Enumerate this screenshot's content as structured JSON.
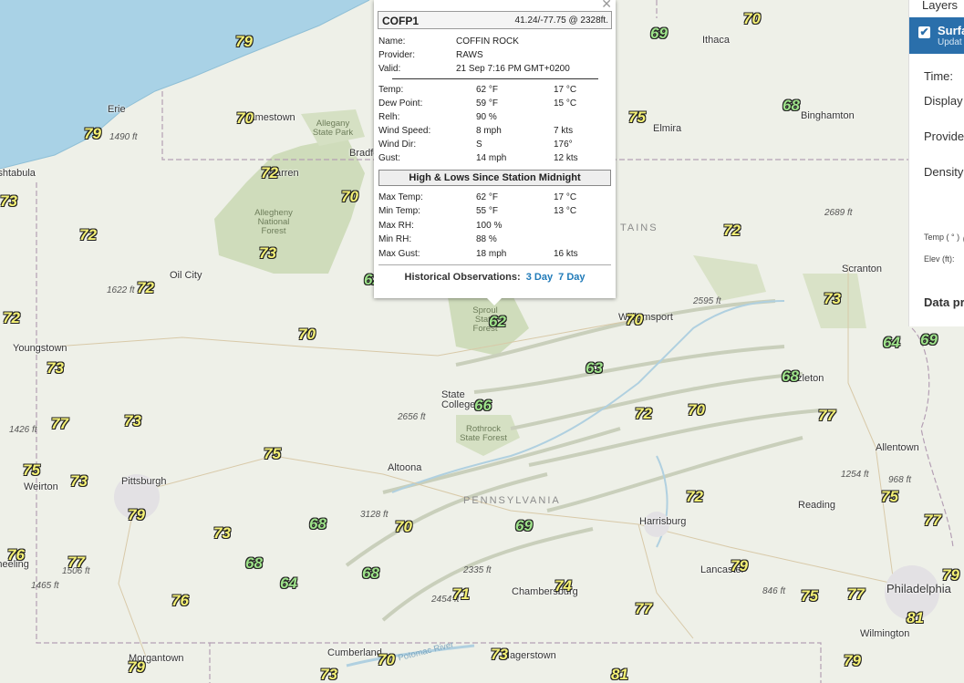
{
  "popup": {
    "station_id": "COFP1",
    "lat_lon_elev": "41.24/-77.75 @ 2328ft.",
    "name_label": "Name:",
    "name_value": "COFFIN ROCK",
    "provider_label": "Provider:",
    "provider_value": "RAWS",
    "valid_label": "Valid:",
    "valid_value": "21 Sep 7:16 PM GMT+0200",
    "obs": [
      {
        "label": "Temp:",
        "english": "62 °F",
        "metric": "17 °C"
      },
      {
        "label": "Dew Point:",
        "english": "59 °F",
        "metric": "15 °C"
      },
      {
        "label": "Relh:",
        "english": "90 %",
        "metric": ""
      },
      {
        "label": "Wind Speed:",
        "english": "8 mph",
        "metric": "7 kts"
      },
      {
        "label": "Wind Dir:",
        "english": "S",
        "metric": "176°"
      },
      {
        "label": "Gust:",
        "english": "14 mph",
        "metric": "12 kts"
      }
    ],
    "section_title": "High & Lows Since Station Midnight",
    "highs_lows": [
      {
        "label": "Max Temp:",
        "english": "62 °F",
        "metric": "17 °C"
      },
      {
        "label": "Min Temp:",
        "english": "55 °F",
        "metric": "13 °C"
      },
      {
        "label": "Max RH:",
        "english": "100 %",
        "metric": ""
      },
      {
        "label": "Min RH:",
        "english": "88 %",
        "metric": ""
      },
      {
        "label": "Max Gust:",
        "english": "18 mph",
        "metric": "16 kts"
      }
    ],
    "historical_label": "Historical Observations:",
    "link_3day": "3 Day",
    "link_7day": "7 Day"
  },
  "panel": {
    "layers_title": "Layers",
    "layer_name": "Surfa",
    "layer_sub": "Updat",
    "time_label": "Time:",
    "display_label": "Display",
    "provider_label": "Provide",
    "density_label": "Density",
    "temp_label": "Temp ( ° )",
    "elev_label": "Elev (ft):",
    "data_label": "Data pr"
  },
  "map": {
    "cities": [
      "Erie",
      "Jamestown",
      "Bradford",
      "Elmira",
      "Binghamton",
      "Ashtabula",
      "Warren",
      "Oil City",
      "Youngstown",
      "Scranton",
      "Williamsport",
      "State College",
      "Hazleton",
      "Allentown",
      "Weirton",
      "Pittsburgh",
      "Altoona",
      "Harrisburg",
      "Reading",
      "Lancaster",
      "Philadelphia",
      "Wilmington",
      "Chambersburg",
      "Morgantown",
      "Cumberland",
      "Hagerstown",
      "Ithaca",
      "Wheeling"
    ],
    "regions": [
      "PENNSYLVANIA",
      "TAINS"
    ],
    "parks": [
      "Allegany State Park",
      "Allegheny National Forest",
      "Sproul State Forest",
      "Rothrock State Forest"
    ],
    "river": "Potomac River",
    "elevations": [
      "1490 ft",
      "1622 ft",
      "2689 ft",
      "2595 ft",
      "2656 ft",
      "1426 ft",
      "3128 ft",
      "1506 ft",
      "1465 ft",
      "2335 ft",
      "2454 ft",
      "1254 ft",
      "968 ft",
      "846 ft"
    ],
    "temps": [
      79,
      70,
      79,
      69,
      70,
      68,
      75,
      72,
      73,
      70,
      72,
      73,
      72,
      72,
      72,
      73,
      70,
      62,
      70,
      73,
      64,
      69,
      63,
      66,
      68,
      77,
      73,
      75,
      72,
      70,
      77,
      75,
      73,
      79,
      68,
      70,
      69,
      72,
      75,
      77,
      76,
      77,
      68,
      64,
      68,
      73,
      71,
      74,
      77,
      79,
      75,
      77,
      79,
      76,
      79,
      70,
      73,
      73,
      81,
      81,
      79,
      62
    ]
  },
  "colors": {
    "cool_temp": "#9ee28a",
    "warm_temp": "#f6f276",
    "lake": "#a9d2e6",
    "forest": "#cfdcbb",
    "link": "#1f7ab8",
    "panel_accent": "#2a6fab"
  }
}
